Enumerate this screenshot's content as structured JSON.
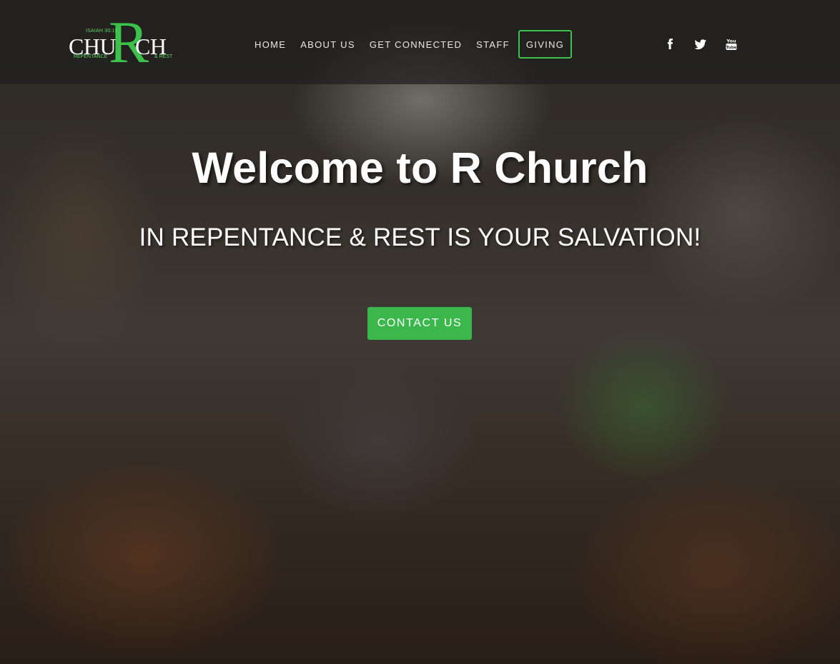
{
  "logo": {
    "verse": "ISAIAH 30:15",
    "letters_left": "CHU",
    "letter_r": "R",
    "letters_right": "CH",
    "tag_left": "REPENTANCE",
    "tag_right": "& REST",
    "accent_color": "#3cc14b"
  },
  "nav": {
    "items": [
      {
        "label": "HOME"
      },
      {
        "label": "ABOUT US"
      },
      {
        "label": "GET CONNECTED"
      },
      {
        "label": "STAFF"
      },
      {
        "label": "GIVING"
      }
    ]
  },
  "social": {
    "icons": [
      "facebook-icon",
      "twitter-icon",
      "youtube-icon"
    ]
  },
  "hero": {
    "title": "Welcome to R Church",
    "subtitle": "IN REPENTANCE & REST IS YOUR SALVATION!",
    "cta_label": "CONTACT US",
    "cta_color": "#3cb74b"
  }
}
